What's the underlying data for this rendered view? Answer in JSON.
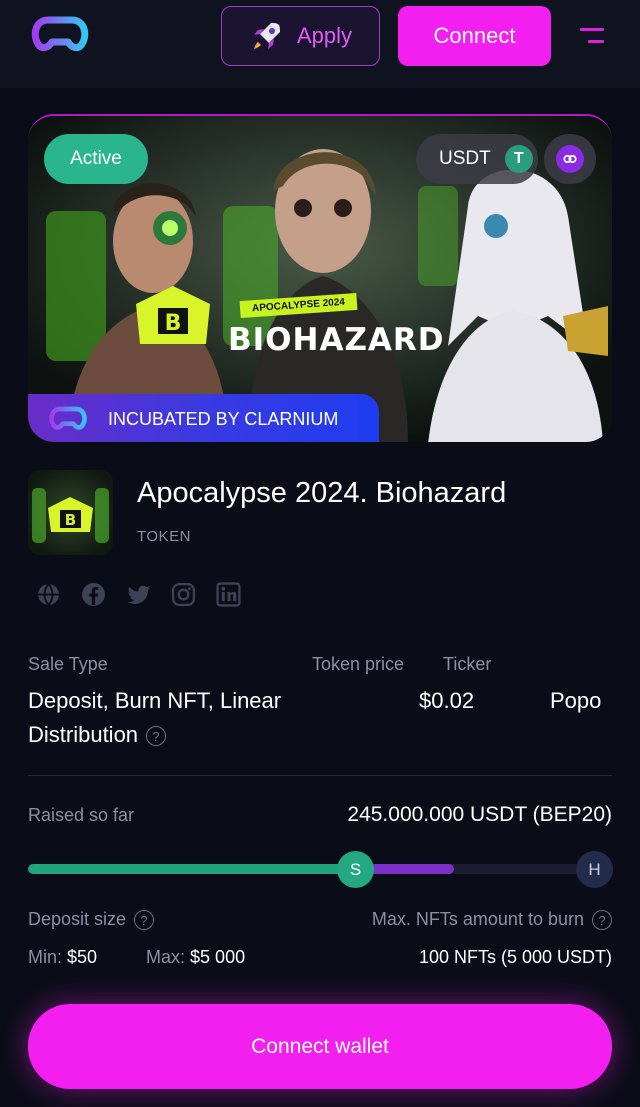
{
  "header": {
    "apply_label": "Apply",
    "connect_label": "Connect"
  },
  "banner": {
    "status": "Active",
    "currency": "USDT",
    "currency_icon": "T",
    "incubated_label": "INCUBATED BY CLARNIUM",
    "art_tag": "APOCALYPSE 2024",
    "art_title": "BIOHAZARD",
    "art_logo": "B"
  },
  "token": {
    "title": "Apocalypse 2024. Biohazard",
    "type": "TOKEN",
    "thumb_letter": "B",
    "socials": [
      "globe-icon",
      "facebook-icon",
      "twitter-icon",
      "instagram-icon",
      "linkedin-icon"
    ]
  },
  "sale": {
    "sale_type_label": "Sale Type",
    "sale_type_line1": "Deposit, Burn NFT, Linear",
    "sale_type_line2": "Distribution",
    "price_label": "Token price",
    "price_value": "$0.02",
    "ticker_label": "Ticker",
    "ticker_value": "Popo"
  },
  "raise": {
    "label": "Raised so far",
    "value": "245.000.000 USDT (BEP20)",
    "progress_soft": 0.56,
    "progress_fill": 0.73,
    "soft_marker": "S",
    "hard_marker": "H"
  },
  "deposit": {
    "label": "Deposit size",
    "min_key": "Min:",
    "min_value": "$50",
    "max_key": "Max:",
    "max_value": "$5 000",
    "burn_label": "Max. NFTs amount to burn",
    "burn_value": "100 NFTs (5 000 USDT)"
  },
  "cta": {
    "label": "Connect wallet"
  },
  "colors": {
    "accent": "#f21ff0",
    "green": "#21a37c",
    "purple": "#7b30c9",
    "background": "#0a0d17"
  }
}
